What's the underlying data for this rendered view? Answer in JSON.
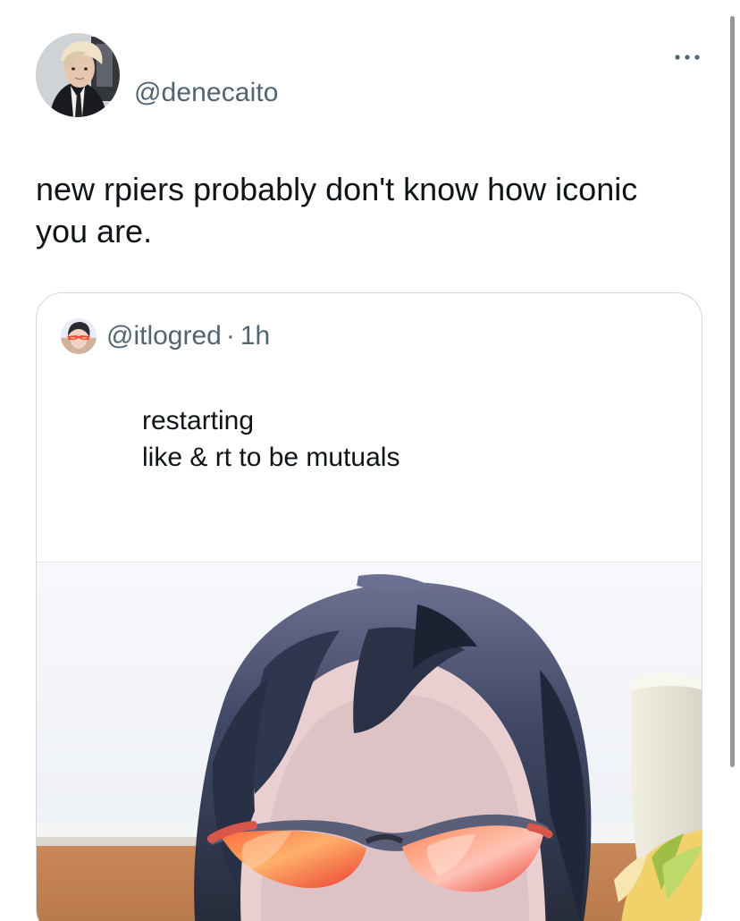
{
  "tweet": {
    "author_handle": "@denecaito",
    "more_icon": "more-horizontal-icon",
    "text": "new rpiers probably don't know how iconic\nyou are.",
    "avatar_icon": "profile-avatar-icon"
  },
  "quoted_tweet": {
    "author_handle": "@itlogred",
    "separator": "·",
    "time": "1h",
    "text": "restarting\nlike & rt to be mutuals",
    "avatar_icon": "quoted-profile-avatar-icon",
    "media_icon": "photo-icon"
  },
  "colors": {
    "primary_text": "#0f1419",
    "secondary_text": "#536471",
    "border": "#cfd9de",
    "background": "#ffffff"
  }
}
